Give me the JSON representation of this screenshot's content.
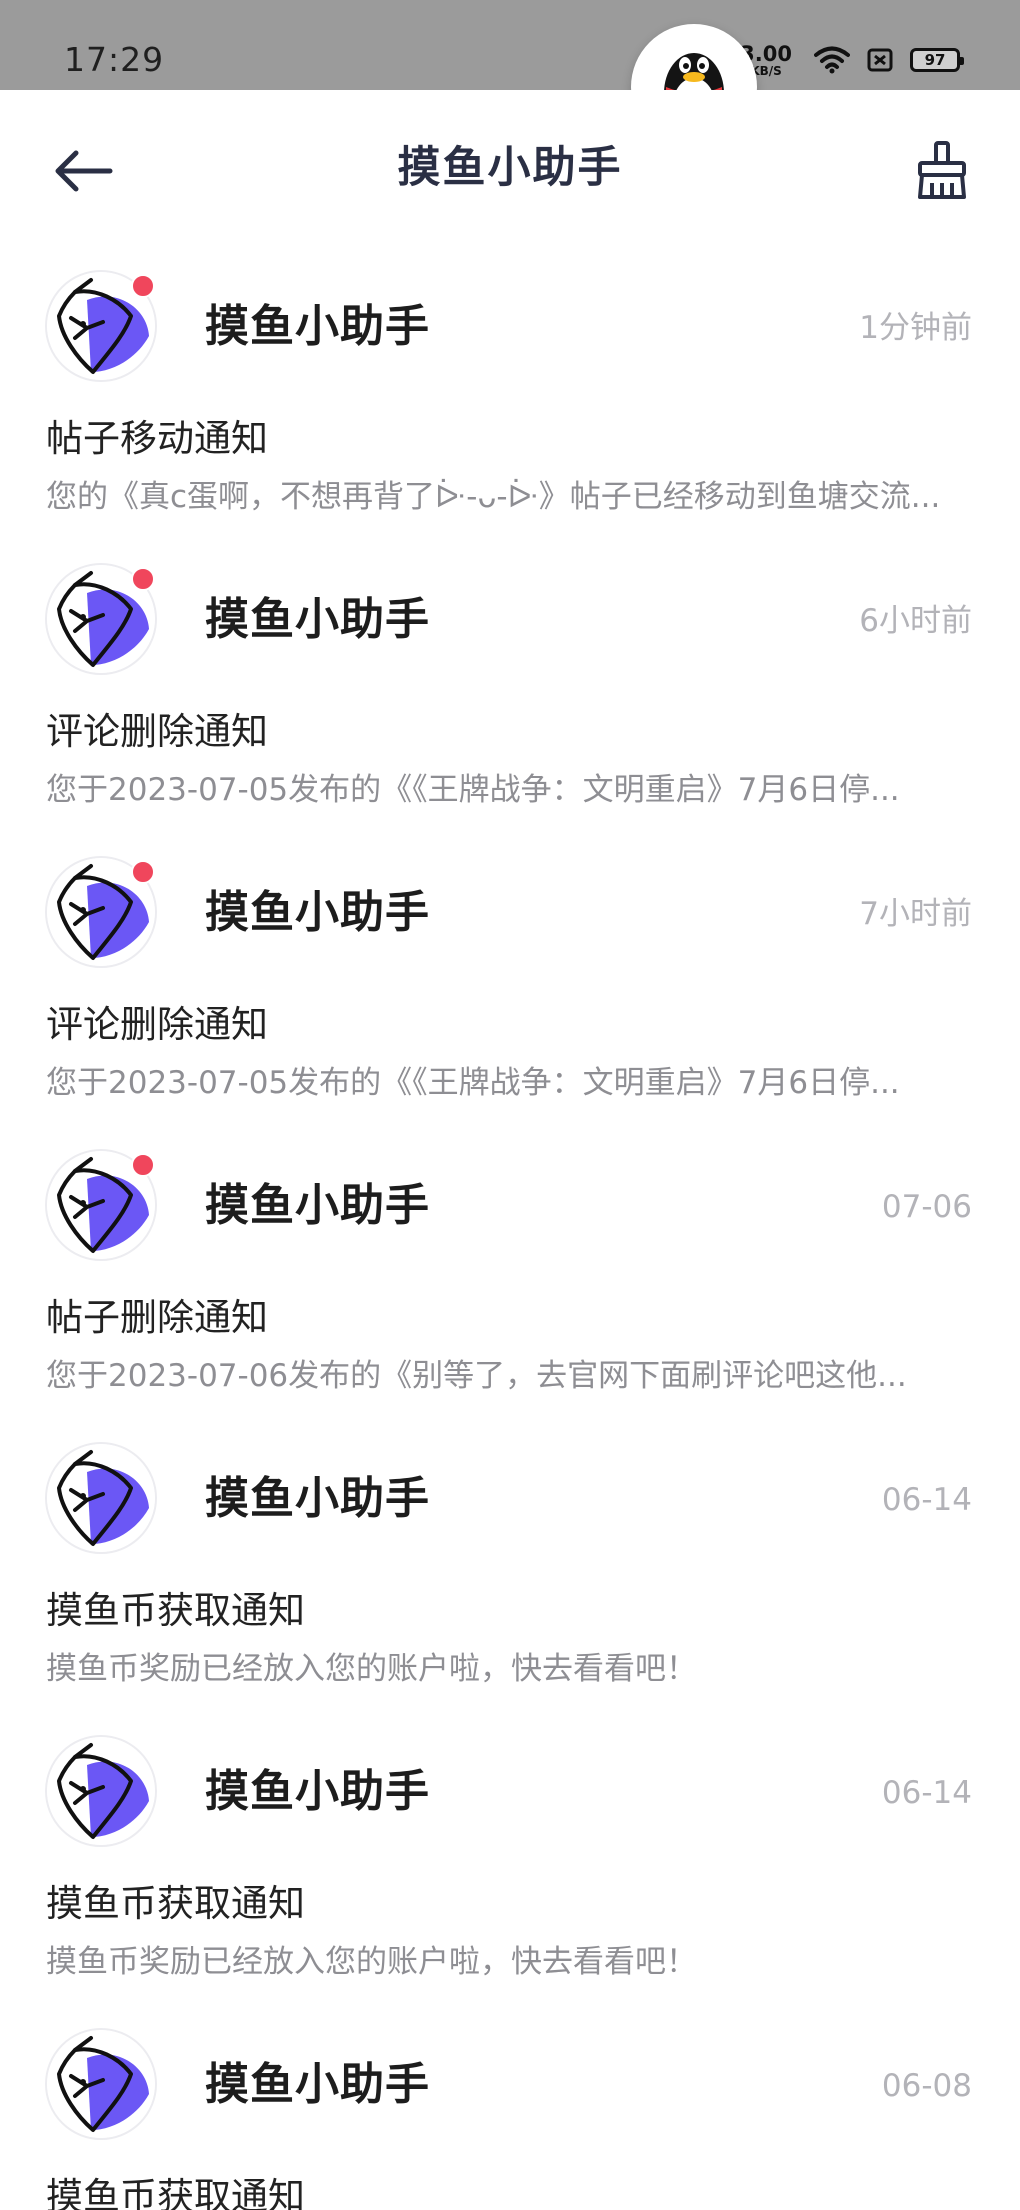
{
  "status_bar": {
    "time": "17:29",
    "net_speed_value": "3.00",
    "net_speed_unit": "KB/S",
    "battery": "97"
  },
  "header": {
    "title": "摸鱼小助手"
  },
  "colors": {
    "accent_purple": "#6b57f5",
    "badge_red": "#f0465c",
    "title_text": "#2a2f44",
    "muted_text": "#8e8e93"
  },
  "messages": [
    {
      "sender": "摸鱼小助手",
      "time": "1分钟前",
      "title": "帖子移动通知",
      "preview": "您的《真c蛋啊，不想再背了ᐕ-ᴗ-ᐕ》帖子已经移动到鱼塘交流...",
      "unread": true
    },
    {
      "sender": "摸鱼小助手",
      "time": "6小时前",
      "title": "评论删除通知",
      "preview": "您于2023-07-05发布的《《王牌战争：文明重启》7月6日停...",
      "unread": true
    },
    {
      "sender": "摸鱼小助手",
      "time": "7小时前",
      "title": "评论删除通知",
      "preview": "您于2023-07-05发布的《《王牌战争：文明重启》7月6日停...",
      "unread": true
    },
    {
      "sender": "摸鱼小助手",
      "time": "07-06",
      "title": "帖子删除通知",
      "preview": "您于2023-07-06发布的《别等了，去官网下面刷评论吧这他...",
      "unread": true
    },
    {
      "sender": "摸鱼小助手",
      "time": "06-14",
      "title": "摸鱼币获取通知",
      "preview": "摸鱼币奖励已经放入您的账户啦，快去看看吧！",
      "unread": false
    },
    {
      "sender": "摸鱼小助手",
      "time": "06-14",
      "title": "摸鱼币获取通知",
      "preview": "摸鱼币奖励已经放入您的账户啦，快去看看吧！",
      "unread": false
    },
    {
      "sender": "摸鱼小助手",
      "time": "06-08",
      "title": "摸鱼币获取通知",
      "preview": "",
      "unread": false
    }
  ]
}
